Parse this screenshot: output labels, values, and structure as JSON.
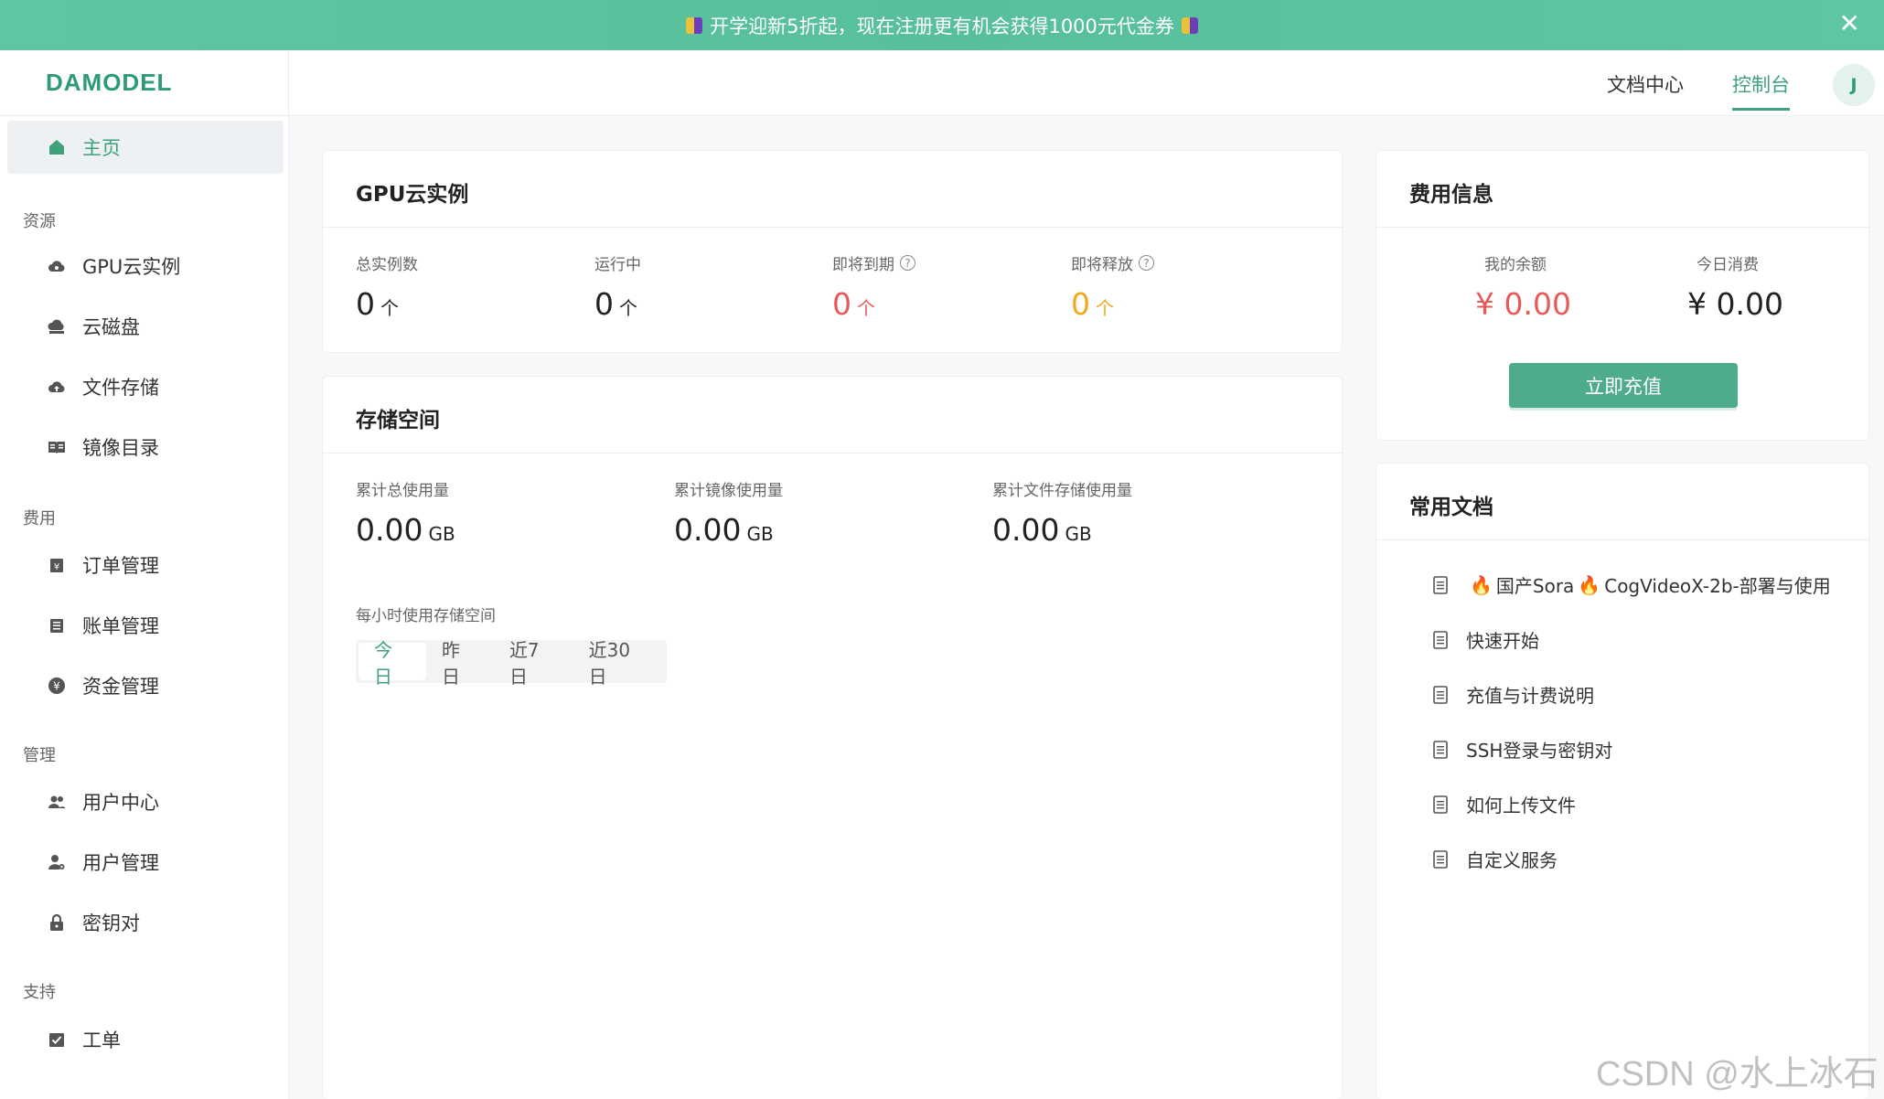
{
  "banner": {
    "text": "开学迎新5折起，现在注册更有机会获得1000元代金券",
    "close_icon": "close-icon"
  },
  "header": {
    "logo": "DAMODEL",
    "nav_docs": "文档中心",
    "nav_console": "控制台",
    "avatar_initial": "J"
  },
  "sidebar": {
    "home": "主页",
    "groups": {
      "resources": "资源",
      "billing": "费用",
      "management": "管理",
      "support": "支持"
    },
    "items": {
      "gpu": "GPU云实例",
      "disk": "云磁盘",
      "file_storage": "文件存储",
      "images": "镜像目录",
      "orders": "订单管理",
      "bills": "账单管理",
      "funds": "资金管理",
      "user_center": "用户中心",
      "user_mgmt": "用户管理",
      "keypair": "密钥对",
      "tickets": "工单"
    }
  },
  "gpu_card": {
    "title": "GPU云实例",
    "stats": [
      {
        "label": "总实例数",
        "value": "0",
        "unit": "个"
      },
      {
        "label": "运行中",
        "value": "0",
        "unit": "个"
      },
      {
        "label": "即将到期",
        "value": "0",
        "unit": "个"
      },
      {
        "label": "即将释放",
        "value": "0",
        "unit": "个"
      }
    ],
    "help_glyph": "?"
  },
  "storage_card": {
    "title": "存储空间",
    "stats": [
      {
        "label": "累计总使用量",
        "value": "0.00",
        "unit": "GB"
      },
      {
        "label": "累计镜像使用量",
        "value": "0.00",
        "unit": "GB"
      },
      {
        "label": "累计文件存储使用量",
        "value": "0.00",
        "unit": "GB"
      }
    ],
    "hourly_label": "每小时使用存储空间",
    "range_tabs": [
      "今日",
      "昨日",
      "近7日",
      "近30日"
    ]
  },
  "fee_card": {
    "title": "费用信息",
    "balance_label": "我的余额",
    "balance_value": "¥ 0.00",
    "today_label": "今日消费",
    "today_value": "¥ 0.00",
    "recharge_label": "立即充值"
  },
  "docs_card": {
    "title": "常用文档",
    "first_prefix": "国产Sora",
    "first_suffix": "CogVideoX-2b-部署与使用",
    "items": [
      "快速开始",
      "充值与计费说明",
      "SSH登录与密钥对",
      "如何上传文件",
      "自定义服务"
    ]
  },
  "watermark": "CSDN @水上冰石",
  "colors": {
    "brand": "#3fa07c",
    "banner": "#5ec7a1",
    "danger": "#e85a5a",
    "warning": "#f0a81e"
  }
}
